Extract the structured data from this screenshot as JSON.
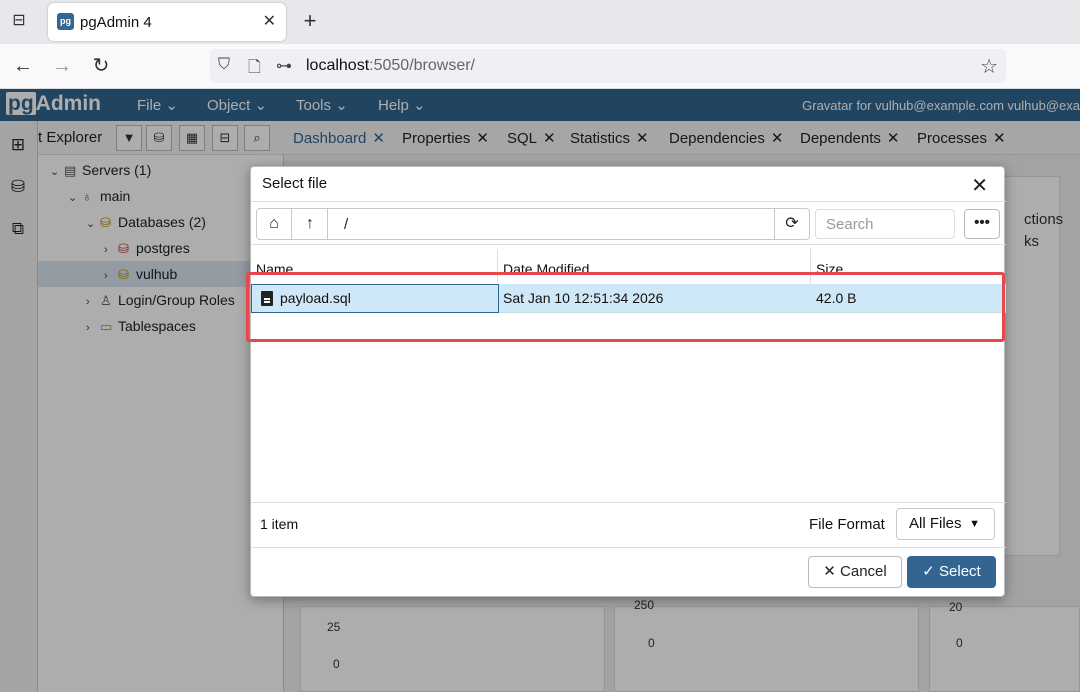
{
  "browser": {
    "tab_title": "pgAdmin 4",
    "tab_favicon": "pg",
    "url_host": "localhost",
    "url_rest": ":5050/browser/"
  },
  "app": {
    "logo_pg": "pg",
    "logo_admin": "Admin",
    "menu": [
      "File",
      "Object",
      "Tools",
      "Help"
    ],
    "gravatar_text": "Gravatar for vulhub@example.com vulhub@exa"
  },
  "explorer": {
    "title": "t Explorer",
    "tree": [
      {
        "label": "Servers (1)"
      },
      {
        "label": "main"
      },
      {
        "label": "Databases (2)"
      },
      {
        "label": "postgres"
      },
      {
        "label": "vulhub"
      },
      {
        "label": "Login/Group Roles"
      },
      {
        "label": "Tablespaces"
      }
    ]
  },
  "main": {
    "tabs": [
      "Dashboard",
      "Properties",
      "SQL",
      "Statistics",
      "Dependencies",
      "Dependents",
      "Processes"
    ],
    "bg_right_text_1": "ctions",
    "bg_right_text_2": "ks",
    "bg_axis": [
      "25",
      "0",
      "250",
      "0",
      "20",
      "0"
    ]
  },
  "dialog": {
    "title": "Select file",
    "path": "/",
    "search_placeholder": "Search",
    "more_label": "•••",
    "columns": [
      "Name",
      "Date Modified",
      "Size"
    ],
    "file": {
      "name": "payload.sql",
      "modified": "Sat Jan 10 12:51:34 2026",
      "size": "42.0 B"
    },
    "count": "1 item",
    "file_format_label": "File Format",
    "file_format_value": "All Files",
    "cancel_label": "Cancel",
    "select_label": "Select"
  },
  "colors": {
    "brand": "#326690",
    "selected_row": "#cfe8f7",
    "highlight": "#e5484d"
  }
}
